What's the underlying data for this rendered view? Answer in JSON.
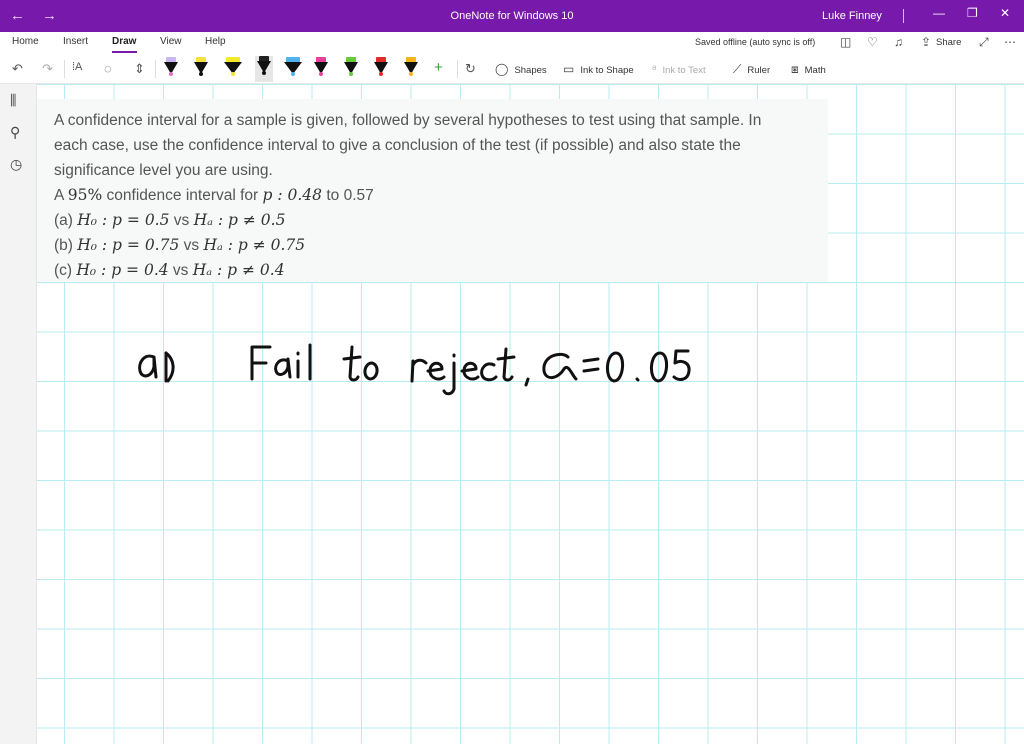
{
  "window": {
    "title": "OneNote for Windows 10",
    "user": "Luke Finney",
    "accent_color": "#7719aa"
  },
  "nav": {
    "back_icon": "arrow-left-icon",
    "forward_icon": "arrow-right-icon"
  },
  "ribbon": {
    "tabs": [
      "Home",
      "Insert",
      "Draw",
      "View",
      "Help"
    ],
    "active_tab": "Draw",
    "status": "Saved offline (auto sync is off)",
    "share_label": "Share"
  },
  "toolbar": {
    "shapes_label": "Shapes",
    "ink_to_shape_label": "Ink to Shape",
    "ink_to_text_label": "Ink to Text",
    "ruler_label": "Ruler",
    "math_label": "Math",
    "pens": [
      {
        "cap": "#c8b6f2",
        "tip": "#e070c0"
      },
      {
        "cap": "#f4e13b",
        "tip": "#111111"
      },
      {
        "cap": "#f3e82a",
        "tip": "#f3e82a"
      },
      {
        "cap": "#222222",
        "tip": "#111111"
      },
      {
        "cap": "#4fb3f0",
        "tip": "#4fb3f0"
      },
      {
        "cap": "#e8409a",
        "tip": "#e8409a"
      },
      {
        "cap": "#66cc33",
        "tip": "#66cc33"
      },
      {
        "cap": "#e12a2a",
        "tip": "#e12a2a"
      },
      {
        "cap": "#f5b21b",
        "tip": "#f5b21b"
      }
    ]
  },
  "problem": {
    "line1": "A confidence interval for a sample is given, followed by several hypotheses to test using that sample. In",
    "line2": "each case, use the confidence interval to give a conclusion of the test (if possible) and also state the",
    "line3": "significance level you are using.",
    "ci_prefix": "A ",
    "ci_level": "95%",
    "ci_mid": " confidence interval for ",
    "ci_var": "p : 0.48",
    "ci_suffix": " to 0.57",
    "part_a_label": "(a) ",
    "part_a_h0": "H₀ : p = 0.5",
    "part_a_ha": "Hₐ : p ≠ 0.5",
    "part_b_label": "(b) ",
    "part_b_h0": "H₀ : p = 0.75",
    "part_b_ha": "Hₐ : p ≠ 0.75",
    "part_c_label": "(c) ",
    "part_c_h0": "H₀ : p = 0.4",
    "part_c_ha": "Hₐ : p ≠ 0.4",
    "vs": " vs "
  },
  "handwriting": {
    "text": "a) Fail to reject , α = 0.05"
  }
}
